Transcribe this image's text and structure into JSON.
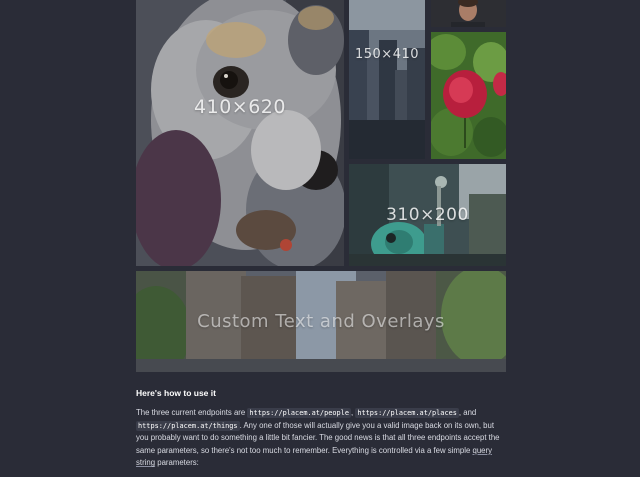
{
  "gallery": {
    "dog_label": "410×620",
    "city_label": "150×410",
    "robot_label": "310×200",
    "street_label": "Custom Text and Overlays"
  },
  "usage": {
    "heading": "Here's how to use it",
    "intro": "The three current endpoints are",
    "endpoint_people": "https://placem.at/people",
    "sep1": ",",
    "endpoint_places": "https://placem.at/places",
    "sep2": ", and",
    "endpoint_things": "https://placem.at/things",
    "body_1": ". Any one of those will actually give you a valid image back on its own, but you probably want to do something a little bit fancier. The good news is that all three endpoints accept the same parameters, so there's not too much to remember. Everything is controlled via a few simple",
    "link_query_string": "query string",
    "body_2": "parameters:"
  }
}
